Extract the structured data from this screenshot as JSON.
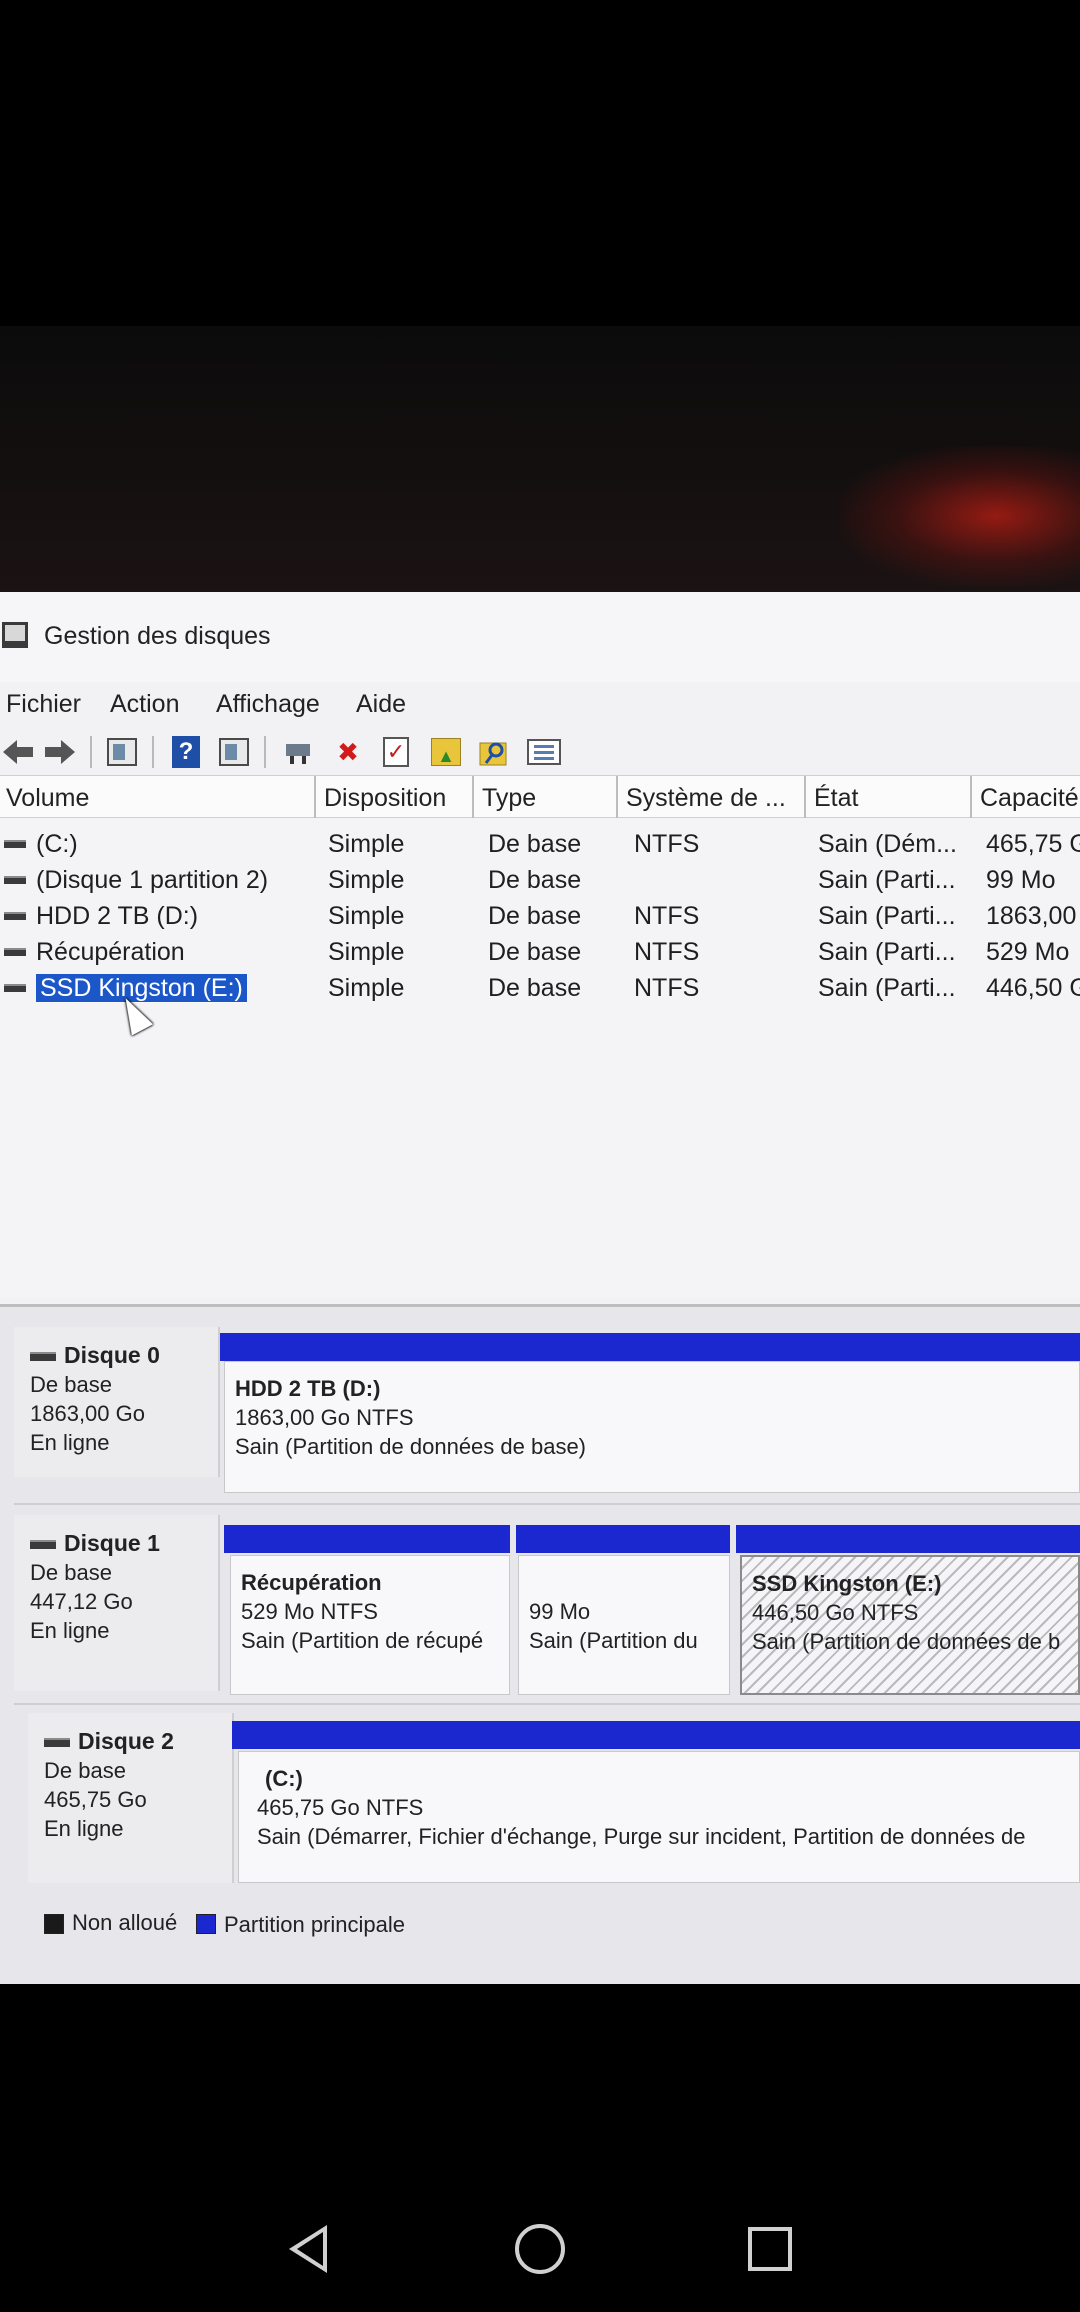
{
  "window": {
    "title": "Gestion des disques"
  },
  "menu": [
    "Fichier",
    "Action",
    "Affichage",
    "Aide"
  ],
  "toolbar": {
    "back_icon": "arrow-left",
    "forward_icon": "arrow-right",
    "delete_glyph": "✖",
    "check_glyph": "✓",
    "help_glyph": "?"
  },
  "volume_table": {
    "columns": [
      "Volume",
      "Disposition",
      "Type",
      "Système de ...",
      "État",
      "Capacité"
    ],
    "rows": [
      {
        "volume": "(C:)",
        "disposition": "Simple",
        "type": "De base",
        "fs": "NTFS",
        "state": "Sain (Dém...",
        "capacity": "465,75 G"
      },
      {
        "volume": "(Disque 1 partition 2)",
        "disposition": "Simple",
        "type": "De base",
        "fs": "",
        "state": "Sain (Parti...",
        "capacity": "99 Mo"
      },
      {
        "volume": "HDD 2 TB (D:)",
        "disposition": "Simple",
        "type": "De base",
        "fs": "NTFS",
        "state": "Sain (Parti...",
        "capacity": "1863,00"
      },
      {
        "volume": "Récupération",
        "disposition": "Simple",
        "type": "De base",
        "fs": "NTFS",
        "state": "Sain (Parti...",
        "capacity": "529 Mo"
      },
      {
        "volume": "SSD Kingston (E:)",
        "disposition": "Simple",
        "type": "De base",
        "fs": "NTFS",
        "state": "Sain (Parti...",
        "capacity": "446,50 G"
      }
    ],
    "selected_index": 4
  },
  "disks": [
    {
      "name": "Disque 0",
      "kind": "De base",
      "size": "1863,00 Go",
      "status": "En ligne",
      "partitions": [
        {
          "name": "HDD 2 TB  (D:)",
          "size_fs": "1863,00 Go NTFS",
          "status": "Sain (Partition de données de base)"
        }
      ]
    },
    {
      "name": "Disque 1",
      "kind": "De base",
      "size": "447,12 Go",
      "status": "En ligne",
      "partitions": [
        {
          "name": "Récupération",
          "size_fs": "529 Mo NTFS",
          "status": "Sain (Partition de récupé"
        },
        {
          "name": "",
          "size_fs": "99 Mo",
          "status": "Sain (Partition du"
        },
        {
          "name": "SSD Kingston  (E:)",
          "size_fs": "446,50 Go NTFS",
          "status": "Sain (Partition de données de b"
        }
      ]
    },
    {
      "name": "Disque 2",
      "kind": "De base",
      "size": "465,75 Go",
      "status": "En ligne",
      "partitions": [
        {
          "name": "(C:)",
          "size_fs": "465,75 Go NTFS",
          "status": "Sain (Démarrer, Fichier d'échange, Purge sur incident, Partition de données de"
        }
      ]
    }
  ],
  "legend": [
    {
      "label": "Non alloué",
      "color": "#1a1a1a"
    },
    {
      "label": "Partition principale",
      "color": "#1b27cf"
    }
  ],
  "colors": {
    "partition_bar": "#1b27cf",
    "selection": "#1b57c8"
  }
}
